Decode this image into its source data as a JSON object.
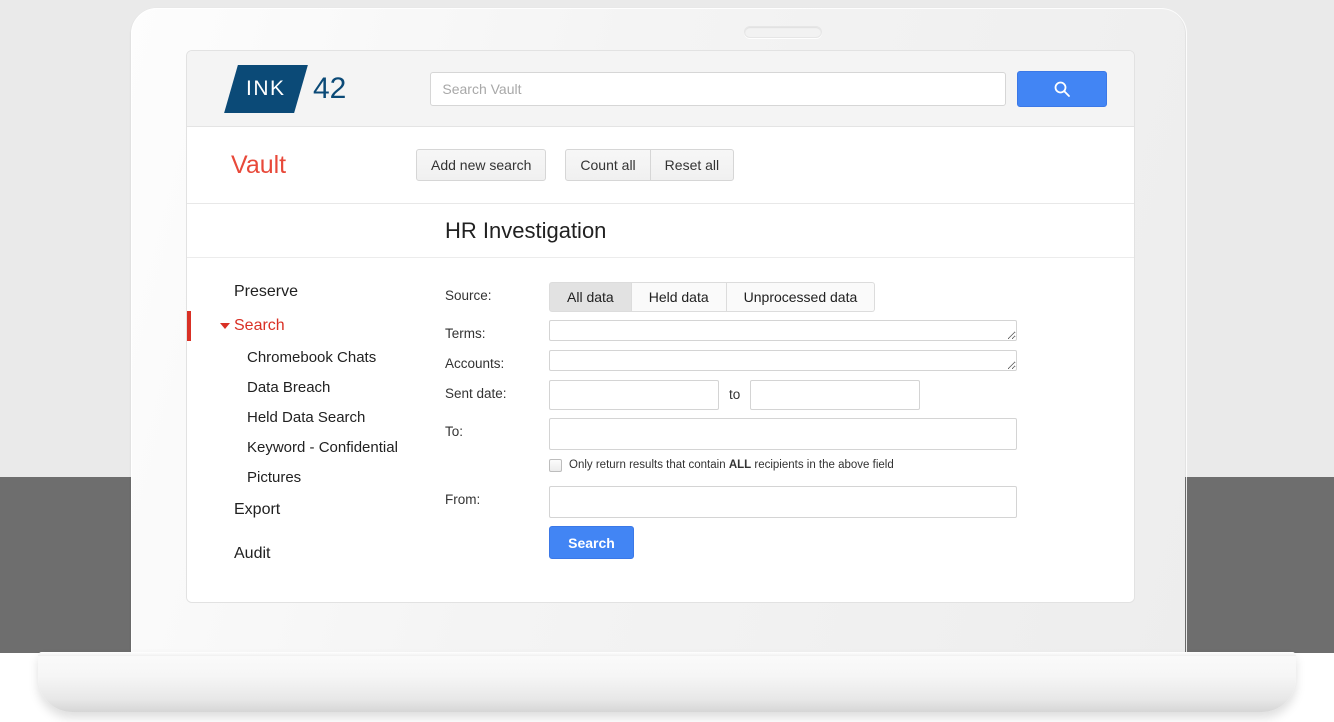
{
  "brand": {
    "mark_text": "INK",
    "number": "42"
  },
  "search": {
    "placeholder": "Search Vault",
    "value": "",
    "button_icon": "search-icon"
  },
  "toolbar": {
    "product_name": "Vault",
    "add_new_search": "Add new search",
    "count_all": "Count all",
    "reset_all": "Reset all"
  },
  "page": {
    "title": "HR Investigation"
  },
  "sidebar": {
    "items": [
      {
        "label": "Preserve",
        "type": "top",
        "active": false
      },
      {
        "label": "Search",
        "type": "top",
        "active": true
      },
      {
        "label": "Chromebook Chats",
        "type": "sub"
      },
      {
        "label": "Data Breach",
        "type": "sub"
      },
      {
        "label": "Held Data Search",
        "type": "sub"
      },
      {
        "label": "Keyword - Confidential",
        "type": "sub"
      },
      {
        "label": "Pictures",
        "type": "sub"
      },
      {
        "label": "Export",
        "type": "top",
        "active": false
      },
      {
        "label": "Audit",
        "type": "top",
        "active": false
      }
    ]
  },
  "form": {
    "source_label": "Source:",
    "source_options": [
      "All data",
      "Held data",
      "Unprocessed data"
    ],
    "source_selected": "All data",
    "terms_label": "Terms:",
    "terms_value": "",
    "accounts_label": "Accounts:",
    "accounts_value": "",
    "sent_date_label": "Sent date:",
    "sent_date_from": "",
    "sent_date_to": "",
    "sent_date_separator": "to",
    "to_label": "To:",
    "to_value": "",
    "all_recipients_checkbox_checked": false,
    "all_recipients_text_before": "Only return results that contain ",
    "all_recipients_text_bold": "ALL",
    "all_recipients_text_after": " recipients in the above field",
    "from_label": "From:",
    "from_value": "",
    "submit_label": "Search"
  },
  "colors": {
    "brand_blue": "#0b4a77",
    "accent_red": "#e8493a",
    "active_red": "#d93025",
    "button_blue": "#4285f4"
  }
}
